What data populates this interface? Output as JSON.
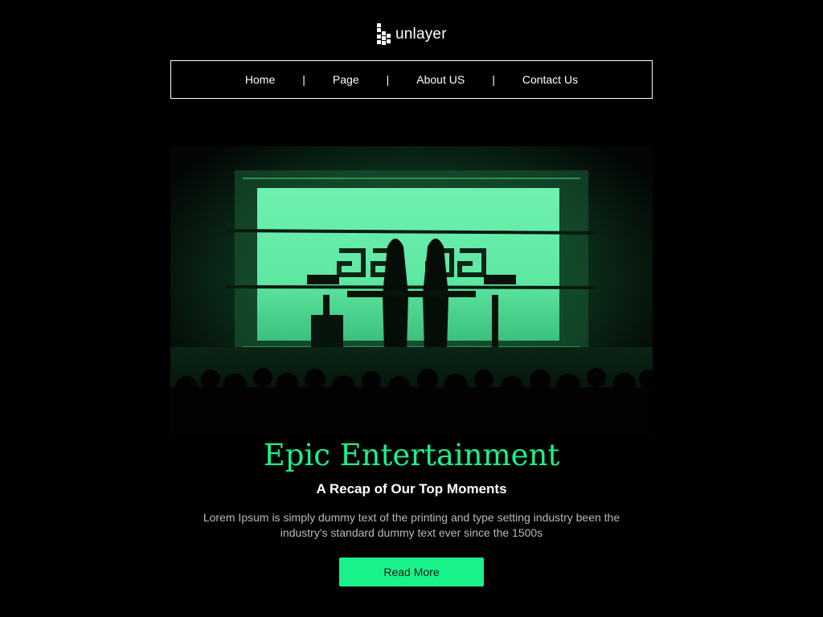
{
  "brand": {
    "name": "unlayer",
    "logo_icon": "unlayer-logo-icon"
  },
  "nav": {
    "items": [
      {
        "label": "Home"
      },
      {
        "label": "Page"
      },
      {
        "label": "About US"
      },
      {
        "label": "Contact Us"
      }
    ],
    "separator": "|"
  },
  "hero": {
    "image": "concert-stage-photo"
  },
  "content": {
    "title": "Epic Entertainment",
    "subtitle": "A Recap of Our Top Moments",
    "description": "Lorem Ipsum is simply dummy text of the printing and type setting industry been the industry's standard dummy text ever since the 1500s",
    "button_label": "Read More"
  },
  "colors": {
    "background": "#000000",
    "accent": "#19f28a",
    "text": "#ffffff",
    "muted_text": "#b8b8b8"
  }
}
